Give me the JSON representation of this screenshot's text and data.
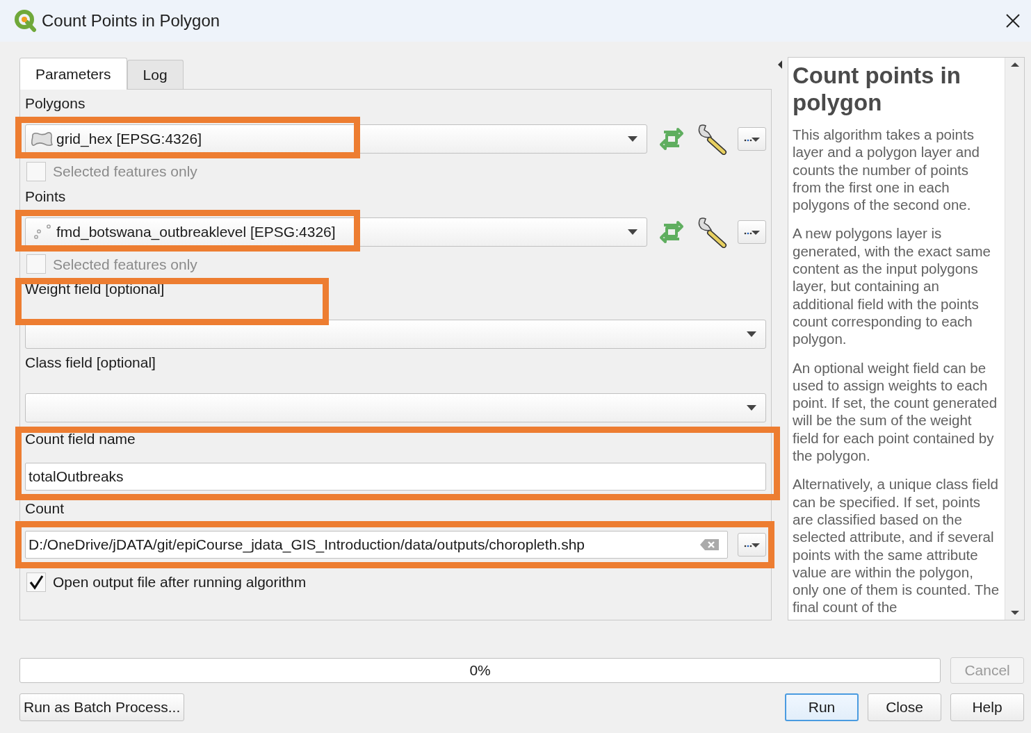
{
  "window": {
    "title": "Count Points in Polygon"
  },
  "tabs": [
    {
      "label": "Parameters",
      "selected": true
    },
    {
      "label": "Log",
      "selected": false
    }
  ],
  "parameters": [
    {
      "kind": "layer",
      "label": "Polygons",
      "layer": {
        "kind": "polygon",
        "name": "grid_hex [EPSG:4326]"
      },
      "highlight_label": false,
      "highlight_input": true,
      "selected_only": {
        "label": "Selected features only",
        "checked": false
      }
    },
    {
      "kind": "layer",
      "label": "Points",
      "layer": {
        "kind": "point",
        "name": "fmd_botswana_outbreaklevel [EPSG:4326]"
      },
      "highlight_label": false,
      "highlight_input": true,
      "selected_only": {
        "label": "Selected features only",
        "checked": false
      }
    },
    {
      "kind": "field",
      "label": "Weight field [optional]",
      "highlight_label": true,
      "highlight_input": false
    },
    {
      "kind": "field",
      "label": "Class field [optional]",
      "highlight_label": false,
      "highlight_input": false
    },
    {
      "kind": "text",
      "label": "Count field name",
      "value": "totalOutbreaks",
      "highlight_label": true,
      "highlight_input": true
    },
    {
      "kind": "file",
      "label": "Count",
      "value": "D:/OneDrive/jDATA/git/epiCourse_jdata_GIS_Introduction/data/outputs/choropleth.shp",
      "highlight_label": false,
      "highlight_input": true
    }
  ],
  "open_output": {
    "label": "Open output file after running algorithm",
    "checked": true
  },
  "help": {
    "title": "Count points in polygon",
    "paragraphs": [
      "This algorithm takes a points layer and a polygon layer and counts the number of points from the first one in each polygons of the second one.",
      "A new polygons layer is generated, with the exact same content as the input polygons layer, but containing an additional field with the points count corresponding to each polygon.",
      "An optional weight field can be used to assign weights to each point. If set, the count generated will be the sum of the weight field for each point contained by the polygon.",
      "Alternatively, a unique class field can be specified. If set, points are classified based on the selected attribute, and if several points with the same attribute value are within the polygon, only one of them is counted. The final count of the"
    ]
  },
  "progress": {
    "level": 0,
    "reading": "0%"
  },
  "cancel_button": {
    "label": "Cancel",
    "disabled": true
  },
  "batch_button": {
    "label": "Run as Batch Process..."
  },
  "action_buttons": [
    {
      "label": "Run",
      "default": true
    },
    {
      "label": "Close",
      "default": false
    },
    {
      "label": "Help",
      "default": false
    }
  ]
}
